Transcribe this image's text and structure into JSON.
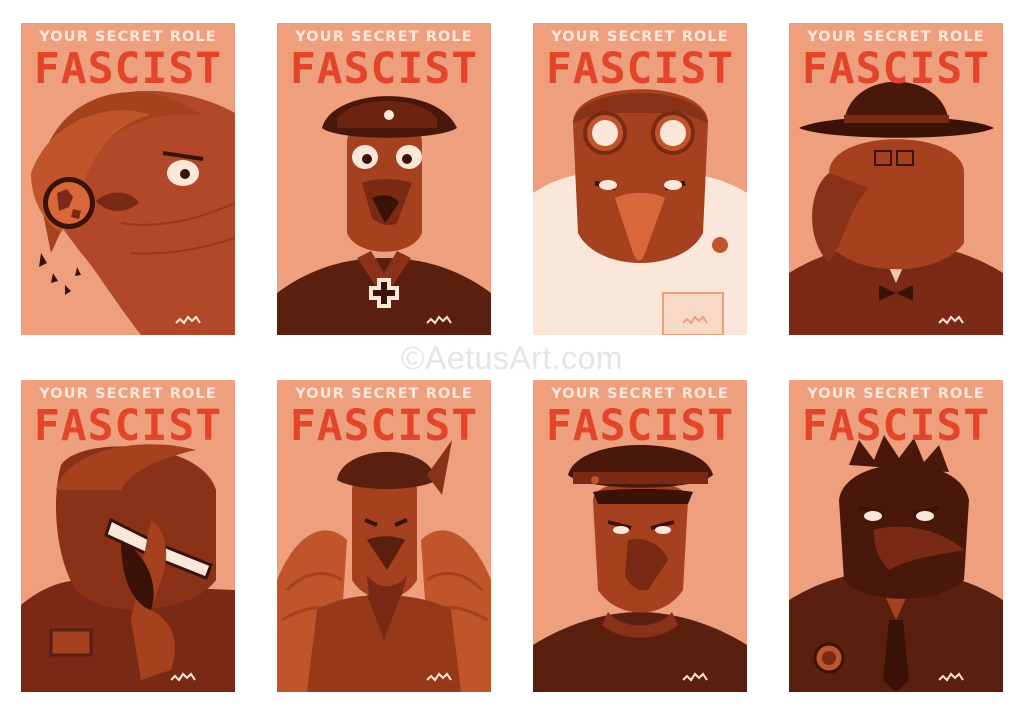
{
  "cards": [
    {
      "subtitle": "YOUR SECRET ROLE",
      "role": "FASCIST"
    },
    {
      "subtitle": "YOUR SECRET ROLE",
      "role": "FASCIST"
    },
    {
      "subtitle": "YOUR SECRET ROLE",
      "role": "FASCIST"
    },
    {
      "subtitle": "YOUR SECRET ROLE",
      "role": "FASCIST"
    },
    {
      "subtitle": "YOUR SECRET ROLE",
      "role": "FASCIST"
    },
    {
      "subtitle": "YOUR SECRET ROLE",
      "role": "FASCIST"
    },
    {
      "subtitle": "YOUR SECRET ROLE",
      "role": "FASCIST"
    },
    {
      "subtitle": "YOUR SECRET ROLE",
      "role": "FASCIST"
    }
  ],
  "watermark": "©AetusArt.com",
  "colors": {
    "card_background": "#eea07e",
    "title_red": "#e3452b",
    "subtitle_cream": "#fbe7da",
    "dark_brown": "#7a2a14",
    "mid_brown": "#a5411f",
    "rust": "#c0552c"
  }
}
